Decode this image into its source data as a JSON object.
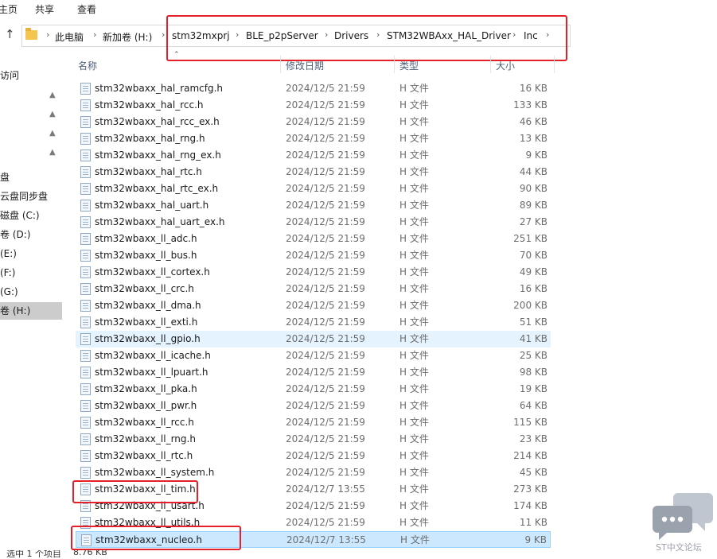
{
  "ribbon": {
    "tabs": [
      "主页",
      "共享",
      "查看"
    ]
  },
  "address": {
    "crumbs": [
      "此电脑",
      "新加卷 (H:)",
      "stm32mxprj",
      "BLE_p2pServer",
      "Drivers",
      "STM32WBAxx_HAL_Driver",
      "Inc"
    ]
  },
  "sidebar": {
    "items": [
      "访问",
      "",
      "",
      "",
      "",
      "盘",
      "云盘同步盘",
      "磁盘 (C:)",
      "卷 (D:)",
      "(E:)",
      "(F:)",
      "(G:)",
      "卷 (H:)"
    ]
  },
  "columns": {
    "name": "名称",
    "date": "修改日期",
    "type": "类型",
    "size": "大小"
  },
  "files": [
    {
      "name": "stm32wbaxx_hal_ramcfg.h",
      "date": "2024/12/5 21:59",
      "type": "H 文件",
      "size": "16 KB"
    },
    {
      "name": "stm32wbaxx_hal_rcc.h",
      "date": "2024/12/5 21:59",
      "type": "H 文件",
      "size": "133 KB"
    },
    {
      "name": "stm32wbaxx_hal_rcc_ex.h",
      "date": "2024/12/5 21:59",
      "type": "H 文件",
      "size": "46 KB"
    },
    {
      "name": "stm32wbaxx_hal_rng.h",
      "date": "2024/12/5 21:59",
      "type": "H 文件",
      "size": "13 KB"
    },
    {
      "name": "stm32wbaxx_hal_rng_ex.h",
      "date": "2024/12/5 21:59",
      "type": "H 文件",
      "size": "9 KB"
    },
    {
      "name": "stm32wbaxx_hal_rtc.h",
      "date": "2024/12/5 21:59",
      "type": "H 文件",
      "size": "44 KB"
    },
    {
      "name": "stm32wbaxx_hal_rtc_ex.h",
      "date": "2024/12/5 21:59",
      "type": "H 文件",
      "size": "90 KB"
    },
    {
      "name": "stm32wbaxx_hal_uart.h",
      "date": "2024/12/5 21:59",
      "type": "H 文件",
      "size": "89 KB"
    },
    {
      "name": "stm32wbaxx_hal_uart_ex.h",
      "date": "2024/12/5 21:59",
      "type": "H 文件",
      "size": "27 KB"
    },
    {
      "name": "stm32wbaxx_ll_adc.h",
      "date": "2024/12/5 21:59",
      "type": "H 文件",
      "size": "251 KB"
    },
    {
      "name": "stm32wbaxx_ll_bus.h",
      "date": "2024/12/5 21:59",
      "type": "H 文件",
      "size": "70 KB"
    },
    {
      "name": "stm32wbaxx_ll_cortex.h",
      "date": "2024/12/5 21:59",
      "type": "H 文件",
      "size": "49 KB"
    },
    {
      "name": "stm32wbaxx_ll_crc.h",
      "date": "2024/12/5 21:59",
      "type": "H 文件",
      "size": "16 KB"
    },
    {
      "name": "stm32wbaxx_ll_dma.h",
      "date": "2024/12/5 21:59",
      "type": "H 文件",
      "size": "200 KB"
    },
    {
      "name": "stm32wbaxx_ll_exti.h",
      "date": "2024/12/5 21:59",
      "type": "H 文件",
      "size": "51 KB"
    },
    {
      "name": "stm32wbaxx_ll_gpio.h",
      "date": "2024/12/5 21:59",
      "type": "H 文件",
      "size": "41 KB"
    },
    {
      "name": "stm32wbaxx_ll_icache.h",
      "date": "2024/12/5 21:59",
      "type": "H 文件",
      "size": "25 KB"
    },
    {
      "name": "stm32wbaxx_ll_lpuart.h",
      "date": "2024/12/5 21:59",
      "type": "H 文件",
      "size": "98 KB"
    },
    {
      "name": "stm32wbaxx_ll_pka.h",
      "date": "2024/12/5 21:59",
      "type": "H 文件",
      "size": "19 KB"
    },
    {
      "name": "stm32wbaxx_ll_pwr.h",
      "date": "2024/12/5 21:59",
      "type": "H 文件",
      "size": "64 KB"
    },
    {
      "name": "stm32wbaxx_ll_rcc.h",
      "date": "2024/12/5 21:59",
      "type": "H 文件",
      "size": "115 KB"
    },
    {
      "name": "stm32wbaxx_ll_rng.h",
      "date": "2024/12/5 21:59",
      "type": "H 文件",
      "size": "23 KB"
    },
    {
      "name": "stm32wbaxx_ll_rtc.h",
      "date": "2024/12/5 21:59",
      "type": "H 文件",
      "size": "214 KB"
    },
    {
      "name": "stm32wbaxx_ll_system.h",
      "date": "2024/12/5 21:59",
      "type": "H 文件",
      "size": "45 KB"
    },
    {
      "name": "stm32wbaxx_ll_tim.h",
      "date": "2024/12/7 13:55",
      "type": "H 文件",
      "size": "273 KB"
    },
    {
      "name": "stm32wbaxx_ll_usart.h",
      "date": "2024/12/5 21:59",
      "type": "H 文件",
      "size": "174 KB"
    },
    {
      "name": "stm32wbaxx_ll_utils.h",
      "date": "2024/12/5 21:59",
      "type": "H 文件",
      "size": "11 KB"
    },
    {
      "name": "stm32wbaxx_nucleo.h",
      "date": "2024/12/7 13:55",
      "type": "H 文件",
      "size": "9 KB"
    }
  ],
  "status": {
    "selected": "选中 1 个项目",
    "size": "8.76 KB"
  },
  "watermark": {
    "text": "ST中文论坛"
  },
  "colors": {
    "highlight_box": "#e4202a",
    "selected_row": "#cce8ff",
    "hover_row": "#e5f3ff"
  }
}
